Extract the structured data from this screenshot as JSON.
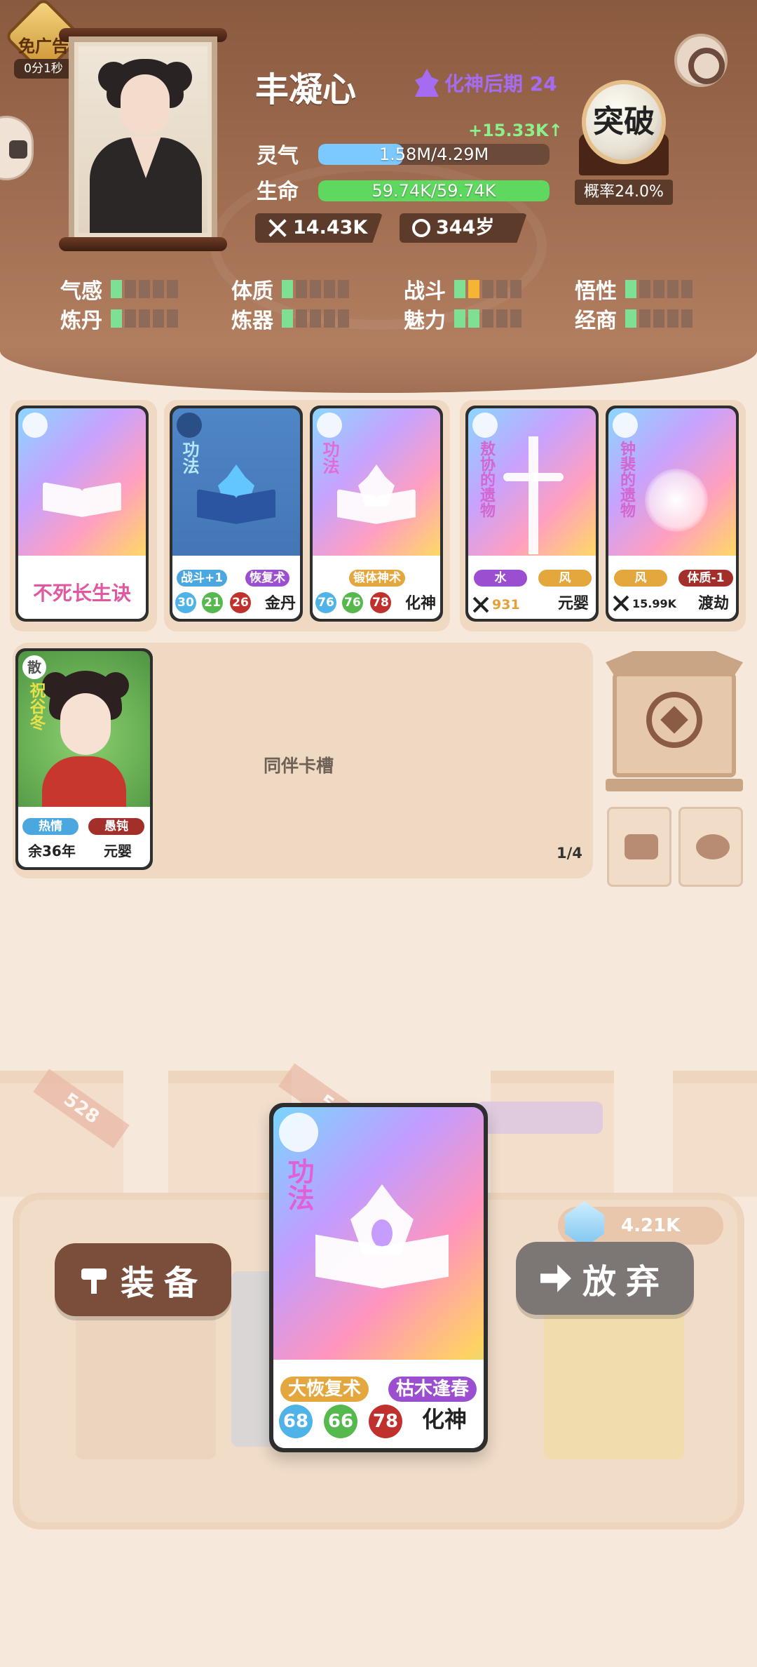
{
  "ad": {
    "label": "免广告",
    "timer": "0分1秒"
  },
  "player": {
    "name": "丰凝心",
    "realm": "化神后期 24",
    "gain": "+15.33K↑",
    "qi_label": "灵气",
    "qi_value": "1.58M/4.29M",
    "qi_fraction": 0.368,
    "life_label": "生命",
    "life_value": "59.74K/59.74K",
    "life_fraction": 1.0,
    "power": "14.43K",
    "age": "344岁"
  },
  "breakthrough": {
    "label": "突破",
    "rate": "概率24.0%"
  },
  "attributes": [
    {
      "label": "气感",
      "level": 1,
      "bonus": 0
    },
    {
      "label": "体质",
      "level": 1,
      "bonus": 0
    },
    {
      "label": "战斗",
      "level": 1,
      "bonus": 1
    },
    {
      "label": "悟性",
      "level": 1,
      "bonus": 0
    },
    {
      "label": "炼丹",
      "level": 1,
      "bonus": 0
    },
    {
      "label": "炼器",
      "level": 1,
      "bonus": 0
    },
    {
      "label": "魅力",
      "level": 2,
      "bonus": 0
    },
    {
      "label": "经商",
      "level": 1,
      "bonus": 0
    }
  ],
  "cards": [
    {
      "name": "不死长生诀"
    },
    {
      "type": "功法",
      "tag1": "战斗+1",
      "tag2": "恢复术",
      "n1": "30",
      "n2": "21",
      "n3": "26",
      "realm": "金丹"
    },
    {
      "type": "功法",
      "tag1": "锻体神术",
      "n1": "76",
      "n2": "76",
      "n3": "78",
      "realm": "化神"
    },
    {
      "name": "敖协的遗物",
      "tag1": "水",
      "tag2": "风",
      "power": "931",
      "realm": "元婴"
    },
    {
      "name": "钟裴的遗物",
      "tag1": "风",
      "tag2": "体质-1",
      "power": "15.99K",
      "realm": "渡劫"
    }
  ],
  "companion": {
    "badge": "散",
    "name": "祝谷冬",
    "tag1": "热情",
    "tag2": "愚钝",
    "life": "余36年",
    "realm": "元婴",
    "slot_label": "同伴卡槽",
    "slot_count": "1/4"
  },
  "stage": {
    "ribbon1": "528",
    "ribbon2": "5",
    "crystals": "4.21K",
    "equip_label": "装备",
    "discard_label": "放弃",
    "card": {
      "type": "功法",
      "tag1": "大恢复术",
      "tag2": "枯木逢春",
      "n1": "68",
      "n2": "66",
      "n3": "78",
      "realm": "化神"
    }
  },
  "colors": {
    "header": "#8a5a3f",
    "qi_bar": "#7cc9ff",
    "life_bar": "#5ed85e",
    "realm_purple": "#a56cf2",
    "attr_on": "#7fe093",
    "attr_bonus": "#f5b433"
  }
}
